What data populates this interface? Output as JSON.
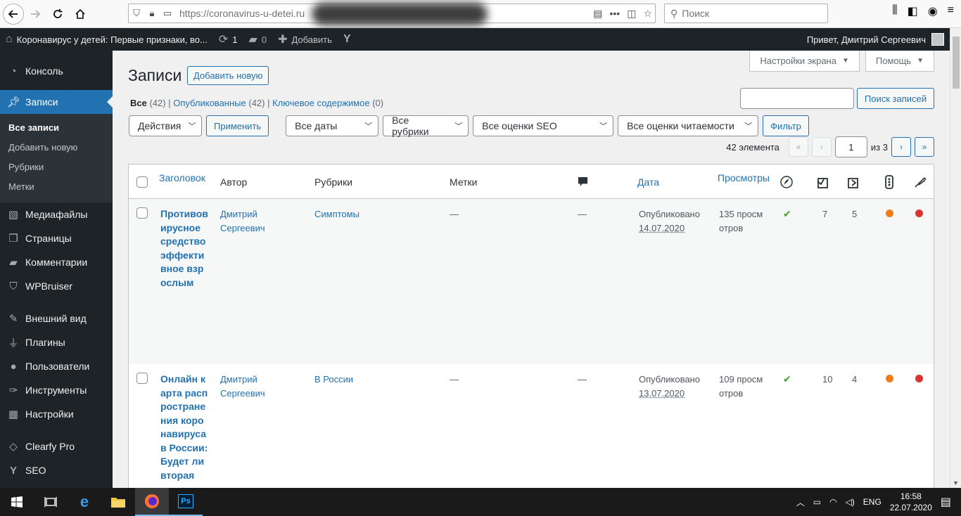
{
  "browser": {
    "url": "https://coronavirus-u-detei.ru",
    "search_placeholder": "Поиск"
  },
  "adminbar": {
    "site_title": "Коронавирус у детей: Первые признаки, во...",
    "updates_count": "1",
    "comments_count": "0",
    "new_label": "Добавить",
    "greeting": "Привет, Дмитрий Сергеевич"
  },
  "sidebar": {
    "items": [
      {
        "label": "Консоль",
        "icon": "dashboard-icon"
      },
      {
        "label": "Записи",
        "icon": "pin-icon"
      },
      {
        "label": "Медиафайлы",
        "icon": "media-icon"
      },
      {
        "label": "Страницы",
        "icon": "pages-icon"
      },
      {
        "label": "Комментарии",
        "icon": "comments-icon"
      },
      {
        "label": "WPBruiser",
        "icon": "shield-icon"
      },
      {
        "label": "Внешний вид",
        "icon": "brush-icon"
      },
      {
        "label": "Плагины",
        "icon": "plugin-icon"
      },
      {
        "label": "Пользователи",
        "icon": "users-icon"
      },
      {
        "label": "Инструменты",
        "icon": "tools-icon"
      },
      {
        "label": "Настройки",
        "icon": "settings-icon"
      },
      {
        "label": "Clearfy Pro",
        "icon": "diamond-icon"
      },
      {
        "label": "SEO",
        "icon": "yoast-icon"
      }
    ],
    "submenu": [
      "Все записи",
      "Добавить новую",
      "Рубрики",
      "Метки"
    ]
  },
  "header": {
    "screen_options": "Настройки экрана",
    "help": "Помощь",
    "title": "Записи",
    "add_new": "Добавить новую"
  },
  "views": {
    "all": "Все",
    "all_count": "(42)",
    "published": "Опубликованные",
    "published_count": "(42)",
    "cornerstone": "Ключевое содержимое",
    "cornerstone_count": "(0)"
  },
  "search": {
    "button": "Поиск записей"
  },
  "filters": {
    "bulk": "Действия",
    "apply": "Применить",
    "dates": "Все даты",
    "categories": "Все рубрики",
    "seo": "Все оценки SEO",
    "readability": "Все оценки читаемости",
    "filter": "Фильтр"
  },
  "pagination": {
    "items": "42 элемента",
    "current": "1",
    "of": "из 3"
  },
  "table": {
    "columns": {
      "title": "Заголовок",
      "author": "Автор",
      "categories": "Рубрики",
      "tags": "Метки",
      "date": "Дата",
      "views": "Просмотры"
    },
    "rows": [
      {
        "title": "Противовирусное средство эффективное взрослым",
        "author": "Дмитрий Сергеевич",
        "category": "Симптомы",
        "tags": "—",
        "comments": "—",
        "status": "Опубликовано",
        "date": "14.07.2020",
        "views": "135 просмотров",
        "links_out": "7",
        "links_in": "5"
      },
      {
        "title": "Онлайн карта распространения коронавируса в России: Будет ли вторая",
        "author": "Дмитрий Сергеевич",
        "category": "В России",
        "tags": "—",
        "comments": "—",
        "status": "Опубликовано",
        "date": "13.07.2020",
        "views": "109 просмотров",
        "links_out": "10",
        "links_in": "4"
      }
    ]
  },
  "colors": {
    "accent": "#2271b1",
    "seo_dot": "#ee7c1b",
    "readability_dot": "#dc3232",
    "check": "#46a31b"
  },
  "taskbar": {
    "lang": "ENG",
    "time": "16:58",
    "date": "22.07.2020"
  }
}
